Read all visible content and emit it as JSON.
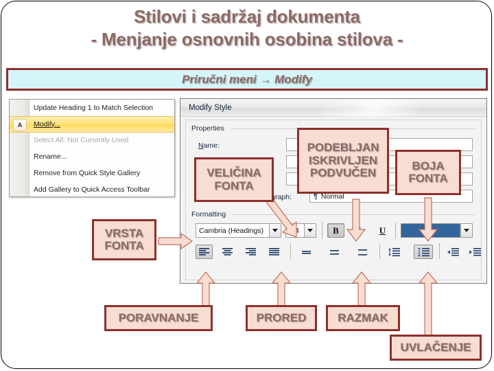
{
  "slide": {
    "title_line1": "Stilovi i sadržaj dokumenta",
    "title_line2": "- Menjanje osnovnih osobina stilova -",
    "subtitle_band": "Priručni meni → Modify",
    "title_color": "#8a6a66",
    "callout_fill": "#f9dcd2",
    "callout_border": "#8c302b",
    "band_fill": "#d4f6fa"
  },
  "context_menu": {
    "items": [
      {
        "label": "Update Heading 1 to Match Selection",
        "state": "normal",
        "accel": "a"
      },
      {
        "label": "Modify...",
        "state": "highlight",
        "accel": "M",
        "icon": "modify-style-icon"
      },
      {
        "label": "Select All: Not Currently Used",
        "state": "disabled",
        "accel": ""
      },
      {
        "label": "Rename...",
        "state": "normal",
        "accel": "n"
      },
      {
        "label": "Remove from Quick Style Gallery",
        "state": "normal",
        "accel": "Q"
      },
      {
        "label": "Add Gallery to Quick Access Toolbar",
        "state": "normal",
        "accel": "A"
      }
    ]
  },
  "dialog": {
    "title": "Modify Style",
    "groups": {
      "properties": "Properties",
      "formatting": "Formatting"
    },
    "labels": {
      "name": "Name:",
      "style_for_following": "Style for following paragraph:"
    },
    "values": {
      "style_for_following": "Normal",
      "pilcrow": "¶",
      "font_family": "Cambria (Headings)",
      "font_size": "14",
      "bold": "B",
      "italic": "I",
      "underline": "U",
      "font_color": "#31659c"
    },
    "toolbar_icons": [
      "align-left-icon",
      "align-center-icon",
      "align-right-icon",
      "align-justify-icon",
      "line-spacing-1-icon",
      "line-spacing-1-5-icon",
      "line-spacing-2-icon",
      "space-before-paragraph-icon",
      "space-after-paragraph-icon",
      "decrease-indent-icon",
      "increase-indent-icon"
    ]
  },
  "callouts": [
    {
      "id": "velicina-fonta",
      "lines": [
        "VELIČINA",
        "FONTA"
      ]
    },
    {
      "id": "podebljan-iskrivljen-podvucen",
      "lines": [
        "PODEBLJAN",
        "ISKRIVLJEN",
        "PODVUČEN"
      ]
    },
    {
      "id": "boja-fonta",
      "lines": [
        "BOJA",
        "FONTA"
      ]
    },
    {
      "id": "vrsta-fonta",
      "lines": [
        "VRSTA",
        "FONTA"
      ]
    },
    {
      "id": "poravnanje",
      "lines": [
        "PORAVNANJE"
      ]
    },
    {
      "id": "prored",
      "lines": [
        "PRORED"
      ]
    },
    {
      "id": "razmak",
      "lines": [
        "RAZMAK"
      ]
    },
    {
      "id": "uvlacenje",
      "lines": [
        "UVLAČENJE"
      ]
    }
  ]
}
